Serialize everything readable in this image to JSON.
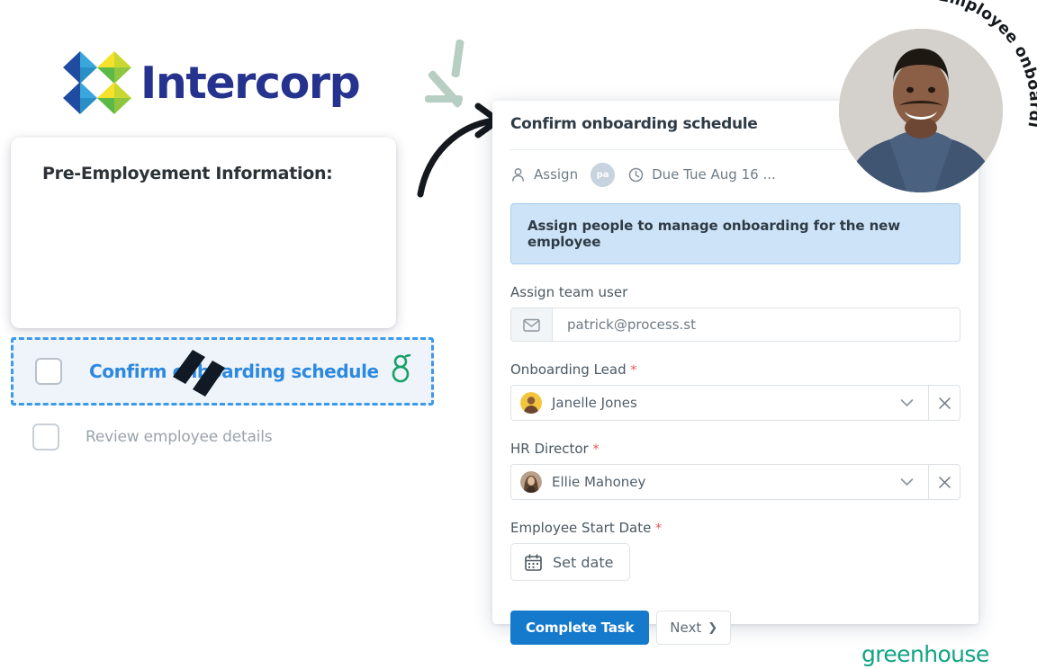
{
  "brand": {
    "name": "Intercorp",
    "logo_colors": [
      "#1f4ba0",
      "#3aa7dc",
      "#f5e02a",
      "#5bb947"
    ]
  },
  "checklist": {
    "title": "Pre-Employement Information:",
    "items": [
      {
        "label": "Confirm onboarding schedule",
        "checked": false,
        "active": true,
        "integration_icon": "greenhouse-g-icon"
      },
      {
        "label": "Review employee details",
        "checked": false,
        "active": false
      }
    ]
  },
  "panel": {
    "title": "Confirm onboarding schedule",
    "meta": {
      "assign_label": "Assign",
      "assignee_initials": "pa",
      "due_label": "Due Tue Aug 16 ...",
      "person_icon": "person-icon",
      "clock_icon": "clock-icon"
    },
    "banner": "Assign people to manage onboarding for the new employee",
    "fields": [
      {
        "label": "Assign team user",
        "required": false,
        "type": "email",
        "icon": "envelope-icon",
        "value": "patrick@process.st"
      },
      {
        "label": "Onboarding Lead",
        "required": true,
        "type": "select",
        "value": "Janelle Jones",
        "chevron_icon": "chevron-down-icon",
        "clear_icon": "close-icon"
      },
      {
        "label": "HR Director",
        "required": true,
        "type": "select",
        "value": "Ellie Mahoney",
        "chevron_icon": "chevron-down-icon",
        "clear_icon": "close-icon"
      },
      {
        "label": "Employee Start Date",
        "required": true,
        "type": "date",
        "value": "Set date",
        "icon": "calendar-icon"
      }
    ],
    "actions": {
      "primary": "Complete Task",
      "secondary": "Next",
      "secondary_chevron": "chevron-right-icon"
    }
  },
  "annotations": {
    "photo_caption": "Employee onboarding",
    "arrow_icon": "curved-arrow-icon",
    "sparkle_icon": "sparkle-lines-icon"
  },
  "footer": {
    "partner_logo": "greenhouse"
  },
  "colors": {
    "accent_blue": "#1579cc",
    "link_blue": "#2d88e0",
    "banner_bg": "#cde4f8",
    "required_red": "#e8564e",
    "greenhouse_green": "#11a383",
    "brand_navy": "#25338e"
  }
}
